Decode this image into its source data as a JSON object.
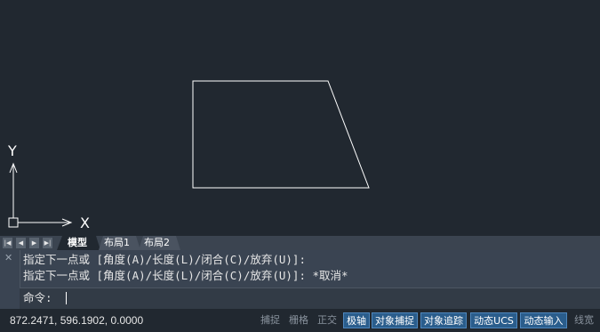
{
  "drawing": {
    "x_axis_label": "X",
    "y_axis_label": "Y"
  },
  "tabs": {
    "nav_first": "|◀",
    "nav_prev": "◀",
    "nav_next": "▶",
    "nav_last": "▶|",
    "model": "模型",
    "layout1": "布局1",
    "layout2": "布局2"
  },
  "command": {
    "close_glyph": "✕",
    "history": [
      "指定下一点或 [角度(A)/长度(L)/闭合(C)/放弃(U)]:",
      "指定下一点或 [角度(A)/长度(L)/闭合(C)/放弃(U)]: *取消*"
    ],
    "prompt": "命令:"
  },
  "status": {
    "coordinates": "872.2471, 596.1902, 0.0000",
    "snap": "捕捉",
    "grid": "栅格",
    "ortho": "正交",
    "polar": "极轴",
    "osnap": "对象捕捉",
    "otrack": "对象追踪",
    "ducs": "动态UCS",
    "dyn": "动态输入",
    "lineweight": "线宽"
  },
  "colors": {
    "background": "#212830",
    "geometry": "#ffffff",
    "toggle_on": "#2a5d8c"
  }
}
